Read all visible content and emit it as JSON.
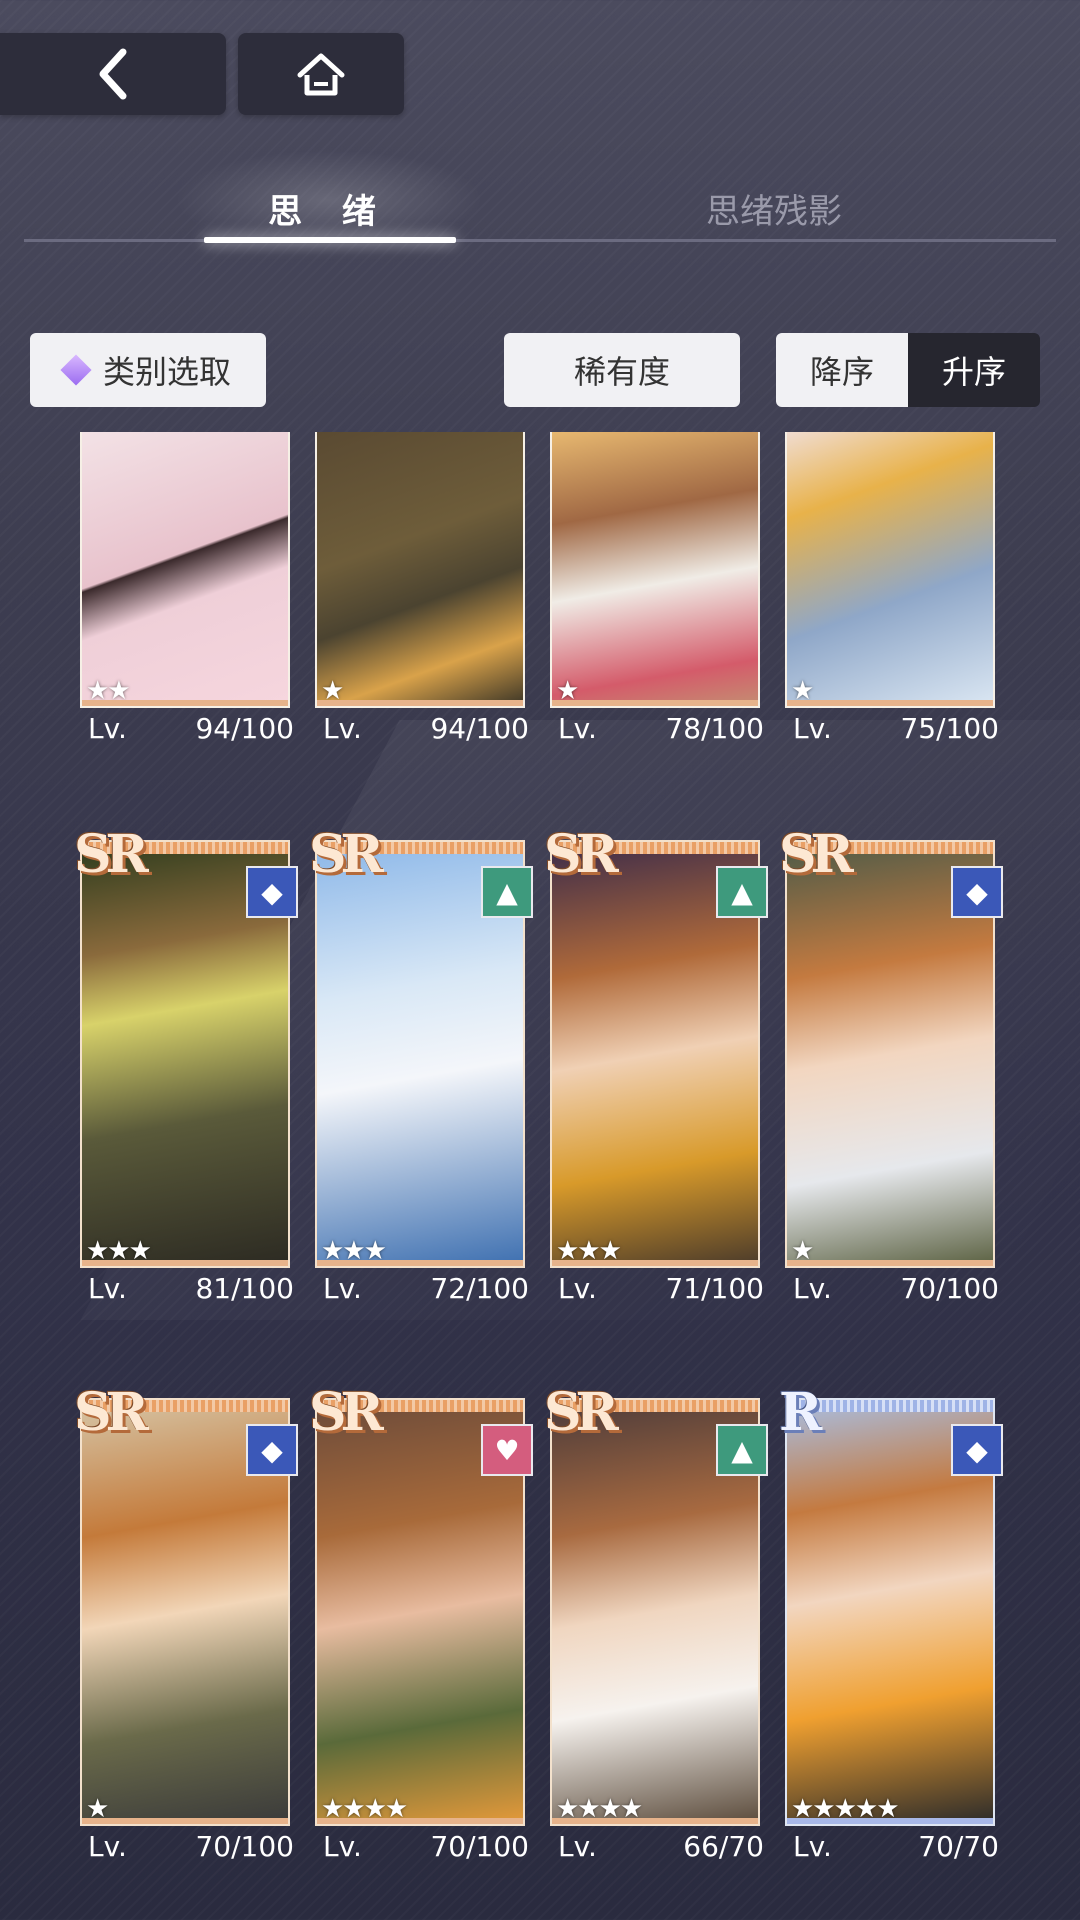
{
  "nav": {
    "back_icon": "chevron-left-icon",
    "home_icon": "home-icon"
  },
  "tabs": [
    {
      "label": "思 绪",
      "active": true
    },
    {
      "label": "思绪残影",
      "active": false
    }
  ],
  "filters": {
    "category_label": "类别选取",
    "rarity_label": "稀有度",
    "sort_desc_label": "降序",
    "sort_asc_label": "升序",
    "sort_selected": "升序"
  },
  "colors": {
    "attr_blue": "#3b58b8",
    "attr_green": "#3e9a7d",
    "attr_pink": "#d45d7e"
  },
  "cards": [
    {
      "rarity": "",
      "attribute": "",
      "stars": 2,
      "lv_label": "Lv.",
      "level": "94/100"
    },
    {
      "rarity": "",
      "attribute": "",
      "stars": 1,
      "lv_label": "Lv.",
      "level": "94/100"
    },
    {
      "rarity": "",
      "attribute": "",
      "stars": 1,
      "lv_label": "Lv.",
      "level": "78/100"
    },
    {
      "rarity": "",
      "attribute": "",
      "stars": 1,
      "lv_label": "Lv.",
      "level": "75/100"
    },
    {
      "rarity": "SR",
      "attribute": "blue",
      "stars": 3,
      "lv_label": "Lv.",
      "level": "81/100"
    },
    {
      "rarity": "SR",
      "attribute": "green",
      "stars": 3,
      "lv_label": "Lv.",
      "level": "72/100"
    },
    {
      "rarity": "SR",
      "attribute": "green",
      "stars": 3,
      "lv_label": "Lv.",
      "level": "71/100"
    },
    {
      "rarity": "SR",
      "attribute": "blue",
      "stars": 1,
      "lv_label": "Lv.",
      "level": "70/100"
    },
    {
      "rarity": "SR",
      "attribute": "blue",
      "stars": 1,
      "lv_label": "Lv.",
      "level": "70/100"
    },
    {
      "rarity": "SR",
      "attribute": "pink",
      "stars": 4,
      "lv_label": "Lv.",
      "level": "70/100"
    },
    {
      "rarity": "SR",
      "attribute": "green",
      "stars": 4,
      "lv_label": "Lv.",
      "level": "66/70"
    },
    {
      "rarity": "R",
      "attribute": "blue",
      "stars": 5,
      "lv_label": "Lv.",
      "level": "70/70"
    }
  ]
}
